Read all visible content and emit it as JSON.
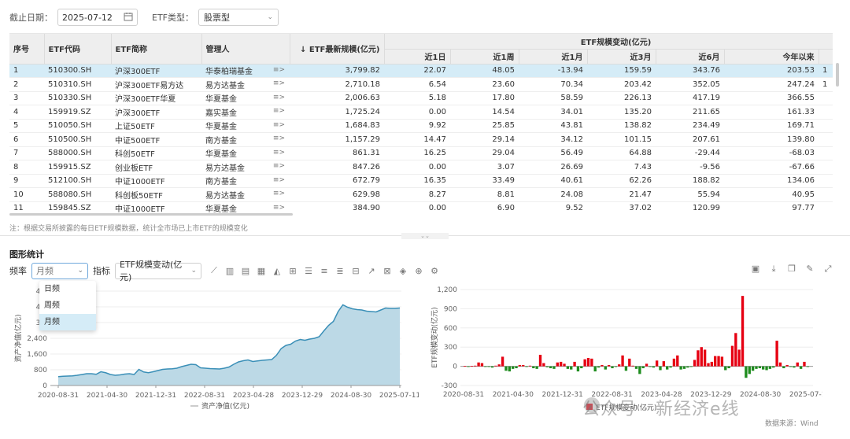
{
  "filter": {
    "date_label": "截止日期：",
    "date_value": "2025-07-12",
    "type_label": "ETF类型：",
    "type_value": "股票型"
  },
  "table": {
    "h_index": "序号",
    "h_code": "ETF代码",
    "h_name": "ETF简称",
    "h_manager": "管理人",
    "h_scale": "↓ ETF最新规模(亿元)",
    "h_change": "ETF规模变动(亿元)",
    "sub": [
      "近1日",
      "近1周",
      "近1月",
      "近3月",
      "近6月",
      "今年以来"
    ],
    "rows": [
      {
        "i": "1",
        "code": "510300.SH",
        "name": "沪深300ETF",
        "mgr": "华泰柏瑞基金",
        "scale": "3,799.82",
        "v": [
          "22.07",
          "48.05",
          "-13.94",
          "159.59",
          "343.76",
          "203.53"
        ],
        "extra": "1"
      },
      {
        "i": "2",
        "code": "510310.SH",
        "name": "沪深300ETF易方达",
        "mgr": "易方达基金",
        "scale": "2,710.18",
        "v": [
          "6.54",
          "23.60",
          "70.34",
          "203.42",
          "352.05",
          "247.24"
        ],
        "extra": "1"
      },
      {
        "i": "3",
        "code": "510330.SH",
        "name": "沪深300ETF华夏",
        "mgr": "华夏基金",
        "scale": "2,006.63",
        "v": [
          "5.18",
          "17.80",
          "58.59",
          "226.13",
          "417.19",
          "366.55"
        ],
        "extra": ""
      },
      {
        "i": "4",
        "code": "159919.SZ",
        "name": "沪深300ETF",
        "mgr": "嘉实基金",
        "scale": "1,725.24",
        "v": [
          "0.00",
          "14.54",
          "34.01",
          "135.20",
          "211.65",
          "161.33"
        ],
        "extra": ""
      },
      {
        "i": "5",
        "code": "510050.SH",
        "name": "上证50ETF",
        "mgr": "华夏基金",
        "scale": "1,684.83",
        "v": [
          "9.92",
          "25.85",
          "43.81",
          "138.82",
          "234.49",
          "169.71"
        ],
        "extra": ""
      },
      {
        "i": "6",
        "code": "510500.SH",
        "name": "中证500ETF",
        "mgr": "南方基金",
        "scale": "1,157.29",
        "v": [
          "14.47",
          "29.14",
          "34.12",
          "101.15",
          "207.61",
          "139.80"
        ],
        "extra": ""
      },
      {
        "i": "7",
        "code": "588000.SH",
        "name": "科创50ETF",
        "mgr": "华夏基金",
        "scale": "861.31",
        "v": [
          "16.25",
          "29.04",
          "56.49",
          "64.88",
          "-29.44",
          "-68.03"
        ],
        "extra": ""
      },
      {
        "i": "8",
        "code": "159915.SZ",
        "name": "创业板ETF",
        "mgr": "易方达基金",
        "scale": "847.26",
        "v": [
          "0.00",
          "3.07",
          "26.69",
          "7.43",
          "-9.56",
          "-67.66"
        ],
        "extra": ""
      },
      {
        "i": "9",
        "code": "512100.SH",
        "name": "中证1000ETF",
        "mgr": "南方基金",
        "scale": "672.79",
        "v": [
          "16.35",
          "33.49",
          "40.61",
          "62.26",
          "188.82",
          "134.06"
        ],
        "extra": ""
      },
      {
        "i": "10",
        "code": "588080.SH",
        "name": "科创板50ETF",
        "mgr": "易方达基金",
        "scale": "629.98",
        "v": [
          "8.27",
          "8.81",
          "24.08",
          "21.47",
          "55.94",
          "40.95"
        ],
        "extra": ""
      },
      {
        "i": "11",
        "code": "159845.SZ",
        "name": "中证1000ETF",
        "mgr": "华夏基金",
        "scale": "384.90",
        "v": [
          "0.00",
          "6.90",
          "9.52",
          "37.02",
          "120.99",
          "97.77"
        ],
        "extra": ""
      }
    ]
  },
  "note": "注：根据交易所披露的每日ETF规模数据，统计全市场已上市ETF的规模变化",
  "section_title": "图形统计",
  "toolbar": {
    "freq_label": "频率",
    "freq_value": "月频",
    "indicator_label": "指标",
    "indicator_value": "ETF规模变动(亿元)"
  },
  "dropdown": [
    "日频",
    "周频",
    "月频"
  ],
  "icons": {
    "calendar": "calendar-icon",
    "chevron": "chevron-down-icon",
    "menu": "detail-menu-icon"
  },
  "colors": {
    "area_line": "#3a8fb7",
    "area_fill": "#bcd9e6",
    "bar_pos": "#e60012",
    "bar_neg": "#1e8c1e",
    "selected_row": "#d5ecf7"
  },
  "chart_data": [
    {
      "type": "area",
      "title": "",
      "xlabel": "",
      "ylabel": "资产净值(亿元)",
      "legend": "资产净值(亿元)",
      "legend_position": "bottom",
      "x_ticks": [
        "2020-08-31",
        "2021-04-30",
        "2021-12-31",
        "2022-08-31",
        "2023-04-28",
        "2023-12-29",
        "2024-08-30",
        "2025-07-11"
      ],
      "y_ticks": [
        "0",
        "800",
        "1,600",
        "2,400",
        "3,2",
        "4,0",
        "4,8"
      ],
      "ylim": [
        0,
        4800
      ],
      "values": [
        450,
        470,
        480,
        490,
        520,
        560,
        600,
        600,
        570,
        700,
        650,
        560,
        520,
        540,
        580,
        600,
        560,
        820,
        690,
        650,
        700,
        760,
        820,
        840,
        850,
        880,
        960,
        1020,
        1080,
        1060,
        900,
        880,
        860,
        850,
        840,
        880,
        940,
        1080,
        1200,
        1260,
        1300,
        1220,
        1250,
        1280,
        1300,
        1320,
        1540,
        1880,
        2040,
        2100,
        2260,
        2340,
        2300,
        2360,
        2400,
        2480,
        2780,
        3060,
        3260,
        3760,
        4100,
        3980,
        3900,
        3860,
        3840,
        3780,
        3760,
        3740,
        3840,
        3940,
        3920,
        3920,
        3940
      ]
    },
    {
      "type": "bar",
      "title": "",
      "xlabel": "",
      "ylabel": "ETF规模变动(亿元)",
      "legend": "ETF规模变动(亿元)",
      "legend_position": "bottom",
      "x_ticks": [
        "2020-08-31",
        "2021-04-30",
        "2021-12-31",
        "2022-08-31",
        "2023-04-28",
        "2023-12-29",
        "2024-08-30",
        "2025-07-11"
      ],
      "y_ticks": [
        "-300",
        "0",
        "300",
        "600",
        "900",
        "1,200"
      ],
      "ylim": [
        -300,
        1200
      ],
      "values": [
        5,
        -10,
        5,
        10,
        60,
        50,
        -5,
        -10,
        -20,
        10,
        30,
        150,
        -70,
        -80,
        -40,
        -30,
        20,
        20,
        -10,
        10,
        -30,
        -40,
        180,
        50,
        -15,
        -30,
        -40,
        60,
        70,
        40,
        -40,
        -50,
        70,
        -80,
        -30,
        110,
        130,
        120,
        -80,
        -20,
        20,
        -50,
        20,
        -30,
        -10,
        30,
        170,
        -70,
        120,
        10,
        -40,
        -120,
        -30,
        40,
        -10,
        -20,
        90,
        -60,
        80,
        -50,
        -20,
        120,
        170,
        -50,
        -40,
        -20,
        -10,
        100,
        250,
        300,
        260,
        50,
        70,
        160,
        160,
        150,
        -60,
        -30,
        320,
        520,
        260,
        1100,
        -180,
        -120,
        -70,
        -40,
        -30,
        -50,
        -60,
        -40,
        -20,
        400,
        60,
        -30,
        20,
        -10,
        -20,
        60,
        -40,
        70,
        -10
      ]
    }
  ],
  "watermark": "公众号 · 新经济e线",
  "source": "数据来源：Wind"
}
